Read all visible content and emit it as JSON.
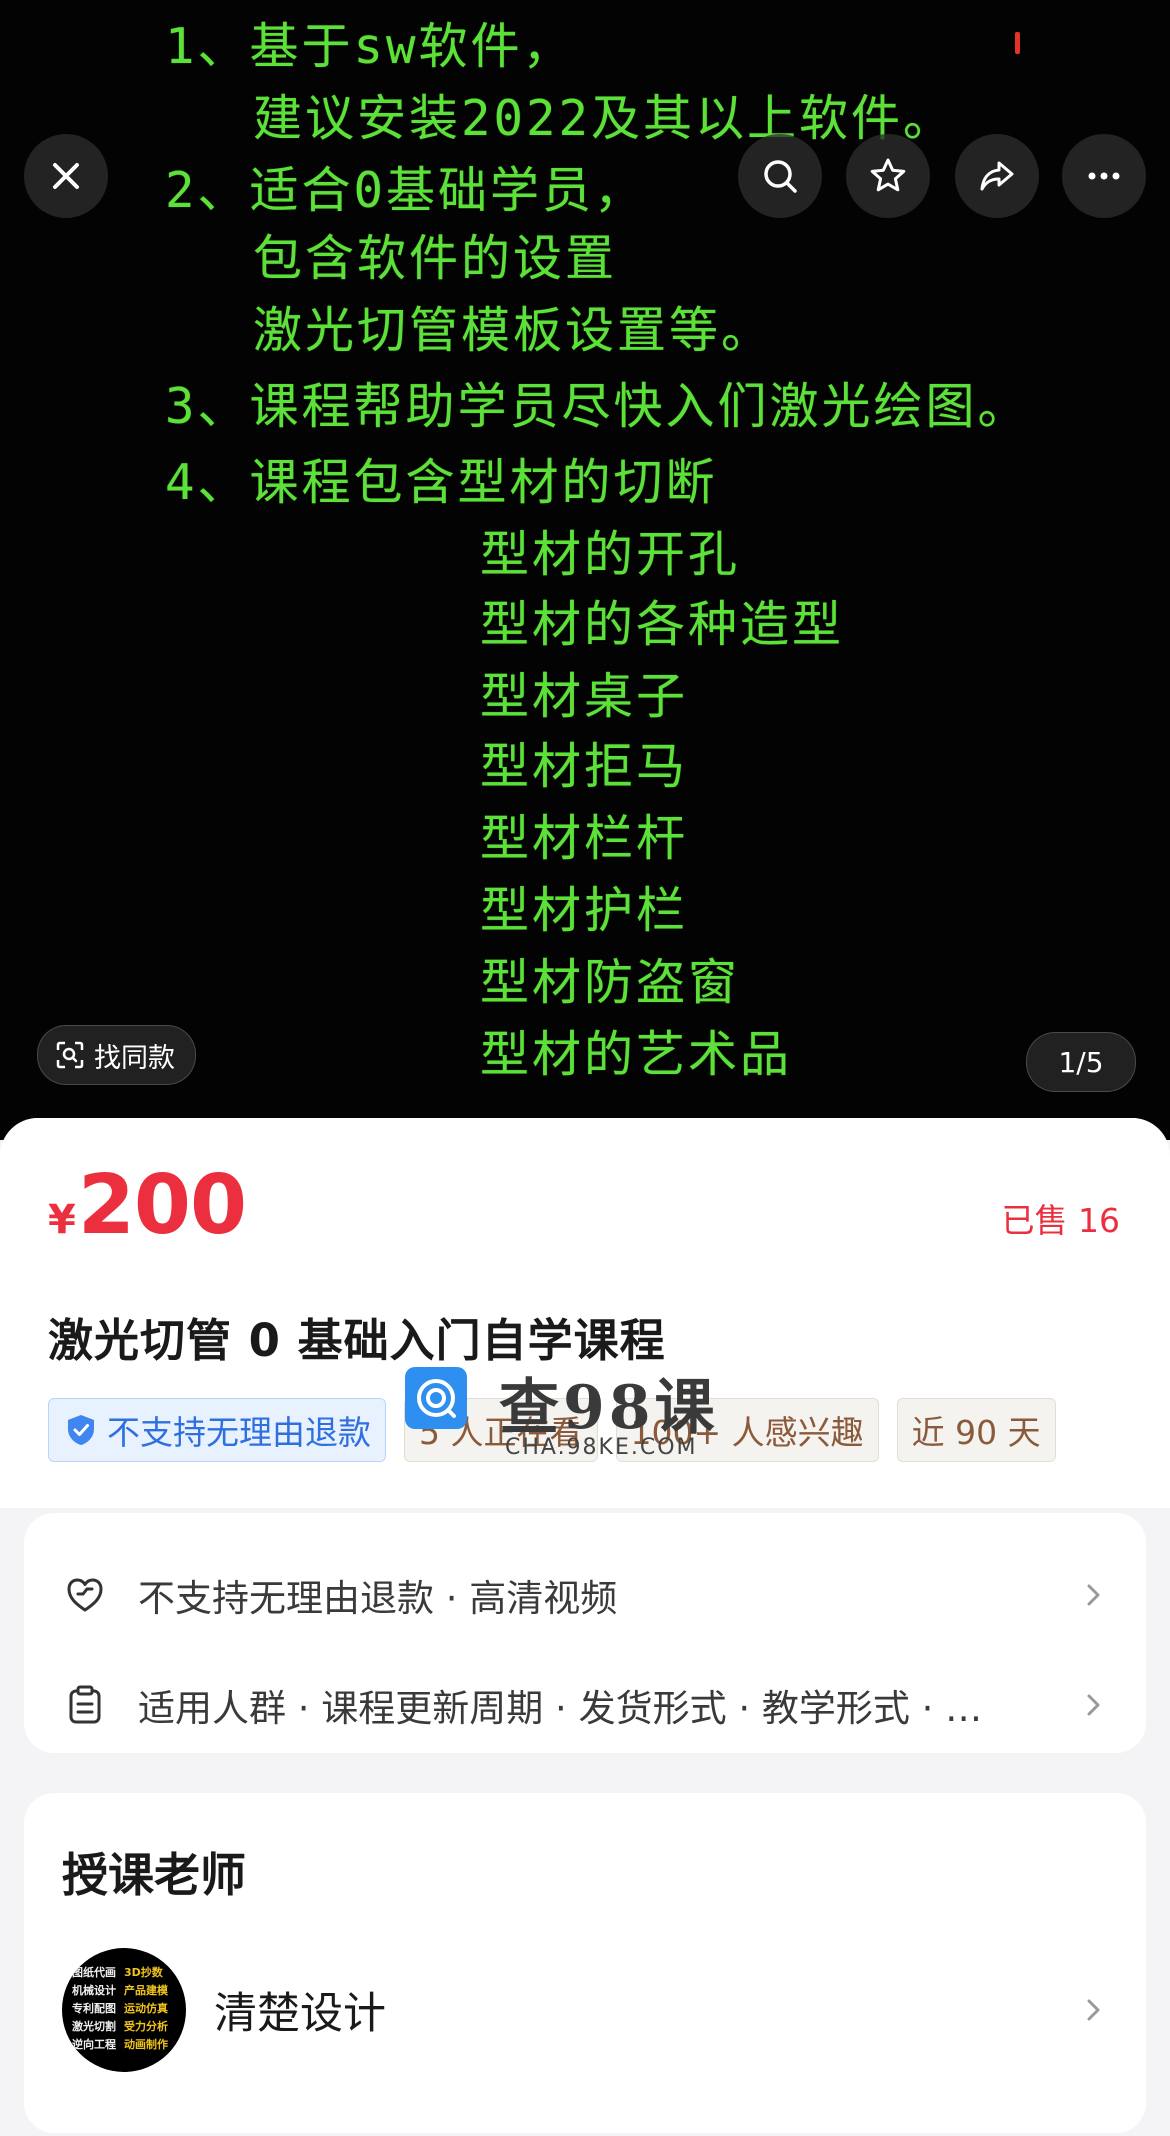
{
  "hero": {
    "lines": [
      "1、基于sw软件，",
      "建议安装2022及其以上软件。",
      "2、适合0基础学员，",
      "包含软件的设置",
      "激光切管模板设置等。",
      "3、课程帮助学员尽快入们激光绘图。",
      "4、课程包含型材的切断",
      "型材的开孔",
      "型材的各种造型",
      "型材桌子",
      "型材拒马",
      "型材栏杆",
      "型材护栏",
      "型材防盗窗",
      "型材的艺术品"
    ],
    "find_similar": "找同款",
    "pager": "1/5",
    "text_color": "#5ee03a"
  },
  "icons": {
    "close": "close-icon",
    "search": "search-icon",
    "star": "star-icon",
    "share": "share-icon",
    "more": "more-icon"
  },
  "product": {
    "currency": "¥",
    "price": "200",
    "sold": "已售 16",
    "title": "激光切管 0 基础入门自学课程",
    "tags": [
      "不支持无理由退款",
      "5 人正在看",
      "100+ 人感兴趣",
      "近 90 天"
    ]
  },
  "watermark": {
    "main": "查98课",
    "sub": "CHA.98KE.COM"
  },
  "services": {
    "row1": "不支持无理由退款 · 高清视频",
    "row2": "适用人群 · 课程更新周期 · 发货形式 · 教学形式 · …"
  },
  "teacher": {
    "section_title": "授课老师",
    "name": "清楚设计",
    "avatar_text": [
      "图纸代画",
      "3D抄数",
      "机械设计",
      "产品建模",
      "专利配图",
      "运动仿真",
      "激光切割",
      "受力分析",
      "逆向工程",
      "动画制作"
    ]
  },
  "colors": {
    "accent_red": "#ec2f3f",
    "tag_blue": "#2f6fe0",
    "hero_bg": "#030303"
  }
}
